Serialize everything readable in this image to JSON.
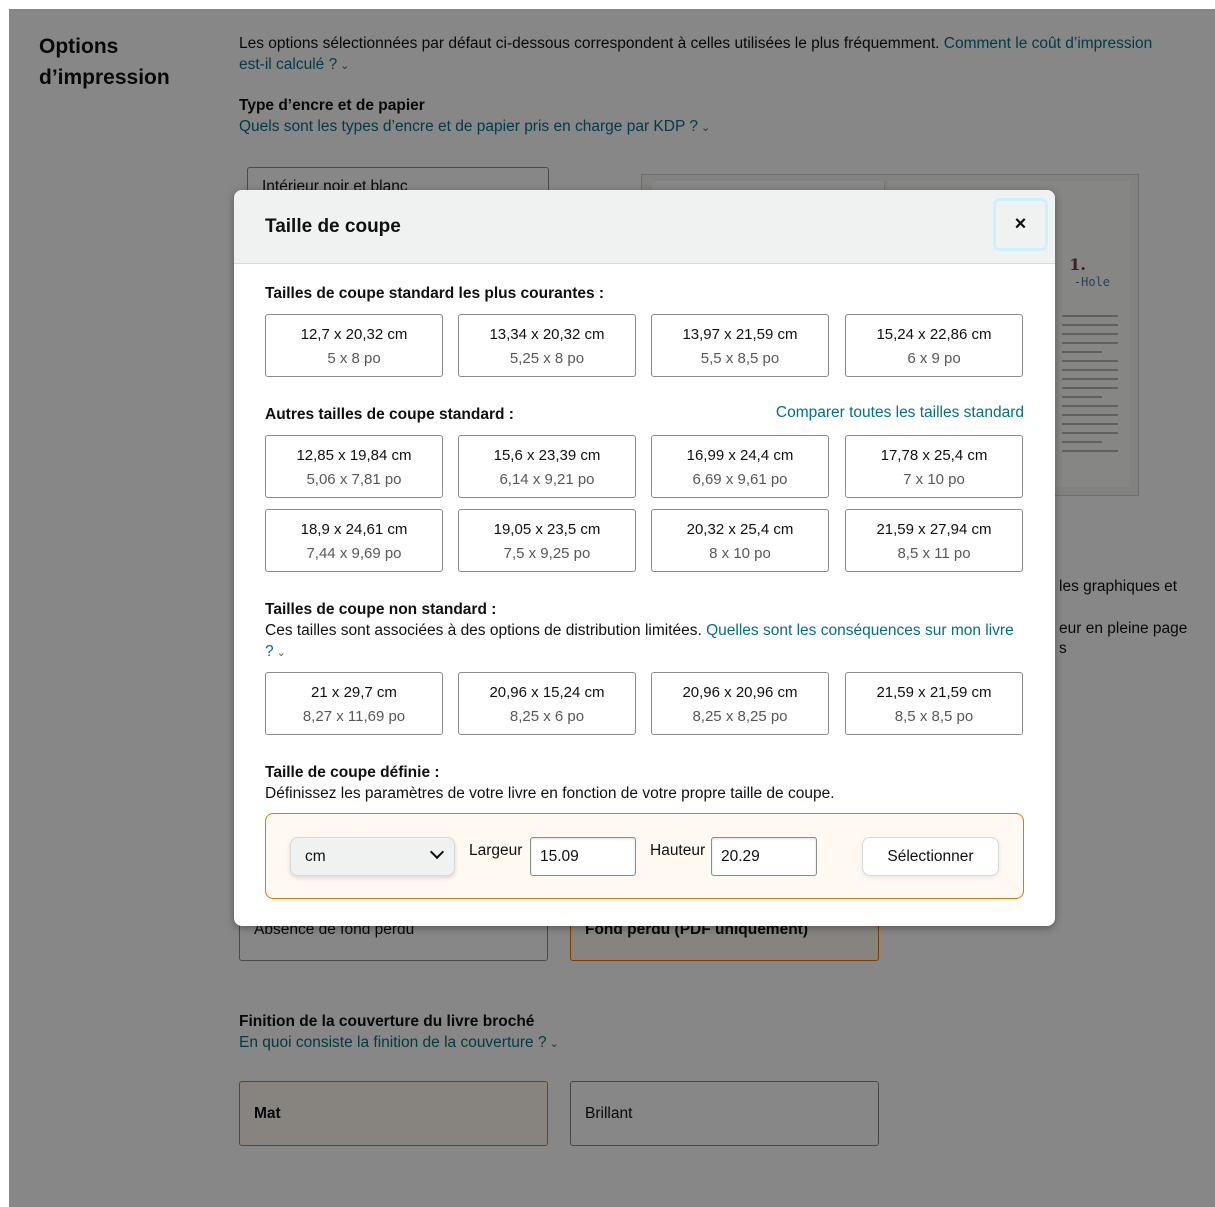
{
  "page": {
    "section_title": "Options d’impression",
    "intro_text": "Les options sélectionnées par défaut ci-dessous correspondent à celles utilisées le plus fréquemment. ",
    "intro_link": "Comment le coût d’impression est-il calculé ?",
    "ink_heading": "Type d’encre et de papier",
    "ink_link": "Quels sont les types d’encre et de papier pris en charge par KDP ?",
    "ink_option_1": "Intérieur noir et blanc",
    "book_chapter": "1.",
    "book_heading": "-Hole",
    "side_text_1": "les graphiques et",
    "side_text_2": "eur en pleine page",
    "side_text_3": "s",
    "bleed_option_1": "Absence de fond perdu",
    "bleed_option_2": "Fond perdu (PDF uniquement)",
    "finish_heading": "Finition de la couverture du livre broché",
    "finish_link": "En quoi consiste la finition de la couverture ?",
    "finish_option_1": "Mat",
    "finish_option_2": "Brillant",
    "colors": {
      "link": "#007185",
      "accent_orange": "#e77600",
      "overlay": "rgba(0,0,0,0.47)"
    }
  },
  "modal": {
    "title": "Taille de coupe",
    "close_symbol": "×",
    "standard_heading": "Tailles de coupe standard les plus courantes :",
    "standard_sizes": [
      {
        "cm": "12,7 x 20,32 cm",
        "in": "5 x 8 po"
      },
      {
        "cm": "13,34 x 20,32 cm",
        "in": "5,25 x 8 po"
      },
      {
        "cm": "13,97 x 21,59 cm",
        "in": "5,5 x 8,5 po"
      },
      {
        "cm": "15,24 x 22,86 cm",
        "in": "6 x 9 po"
      }
    ],
    "other_heading": "Autres tailles de coupe standard :",
    "compare_link": "Comparer toutes les tailles standard",
    "other_sizes": [
      {
        "cm": "12,85 x 19,84 cm",
        "in": "5,06 x 7,81 po"
      },
      {
        "cm": "15,6 x 23,39 cm",
        "in": "6,14 x 9,21 po"
      },
      {
        "cm": "16,99 x 24,4 cm",
        "in": "6,69 x 9,61 po"
      },
      {
        "cm": "17,78 x 25,4 cm",
        "in": "7 x 10 po"
      },
      {
        "cm": "18,9 x 24,61 cm",
        "in": "7,44 x 9,69 po"
      },
      {
        "cm": "19,05 x 23,5 cm",
        "in": "7,5 x 9,25 po"
      },
      {
        "cm": "20,32 x 25,4 cm",
        "in": "8 x 10 po"
      },
      {
        "cm": "21,59 x 27,94 cm",
        "in": "8,5 x 11 po"
      }
    ],
    "nonstandard_heading": "Tailles de coupe non standard :",
    "nonstandard_text": "Ces tailles sont associées à des options de distribution limitées. ",
    "nonstandard_link": "Quelles sont les conséquences sur mon livre ?",
    "nonstandard_sizes": [
      {
        "cm": "21 x 29,7 cm",
        "in": "8,27 x 11,69 po"
      },
      {
        "cm": "20,96 x 15,24 cm",
        "in": "8,25 x 6 po"
      },
      {
        "cm": "20,96 x 20,96 cm",
        "in": "8,25 x 8,25 po"
      },
      {
        "cm": "21,59 x 21,59 cm",
        "in": "8,5 x 8,5 po"
      }
    ],
    "custom_heading": "Taille de coupe définie :",
    "custom_text": "Définissez les paramètres de votre livre en fonction de votre propre taille de coupe.",
    "unit_selected": "cm",
    "width_label": "Largeur",
    "width_value": "15.09",
    "height_label": "Hauteur",
    "height_value": "20.29",
    "select_button": "Sélectionner"
  }
}
